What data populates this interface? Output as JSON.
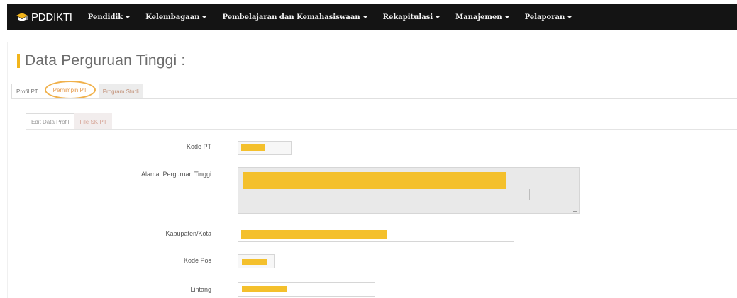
{
  "navbar": {
    "brand": "PDDIKTI",
    "items": [
      {
        "label": "Pendidik"
      },
      {
        "label": "Kelembagaan"
      },
      {
        "label": "Pembelajaran dan Kemahasiswaan"
      },
      {
        "label": "Rekapitulasi"
      },
      {
        "label": "Manajemen"
      },
      {
        "label": "Pelaporan"
      }
    ]
  },
  "page": {
    "title": "Data Perguruan Tinggi :"
  },
  "tabs_primary": [
    {
      "label": "Profil PT"
    },
    {
      "label": "Pemimpin PT"
    },
    {
      "label": "Program Studi"
    }
  ],
  "tabs_secondary": [
    {
      "label": "Edit Data Profil"
    },
    {
      "label": "File SK PT"
    }
  ],
  "form": {
    "kode_pt_label": "Kode PT",
    "alamat_label": "Alamat Perguruan Tinggi",
    "kabupaten_label": "Kabupaten/Kota",
    "kode_pos_label": "Kode Pos",
    "lintang_label": "Lintang"
  },
  "colors": {
    "navbar_bg": "#141414",
    "accent": "#f2b51c",
    "redaction": "#f4c02c",
    "highlight_circle": "#f0b04a"
  }
}
